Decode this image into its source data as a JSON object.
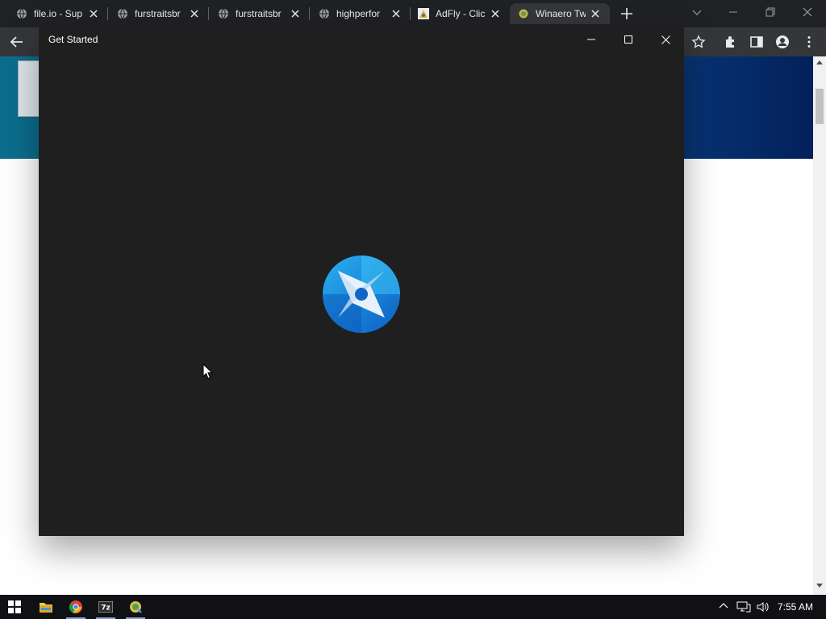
{
  "browser": {
    "tabs": [
      {
        "title": "file.io - Sup"
      },
      {
        "title": "furstraitsbr"
      },
      {
        "title": "furstraitsbr"
      },
      {
        "title": "highperfor"
      },
      {
        "title": "AdFly - Clic"
      },
      {
        "title": "Winaero Tw"
      }
    ]
  },
  "dialog": {
    "title": "Get Started"
  },
  "taskbar": {
    "time": "7:55 AM",
    "apps": [
      "start-icon",
      "file-explorer-icon",
      "chrome-icon",
      "7zip-icon",
      "winaero-tweaker-icon"
    ]
  },
  "colors": {
    "dialog_bg": "#1f1f1f",
    "banner": "#083a7a",
    "logo_blue": "#1e88e5"
  }
}
